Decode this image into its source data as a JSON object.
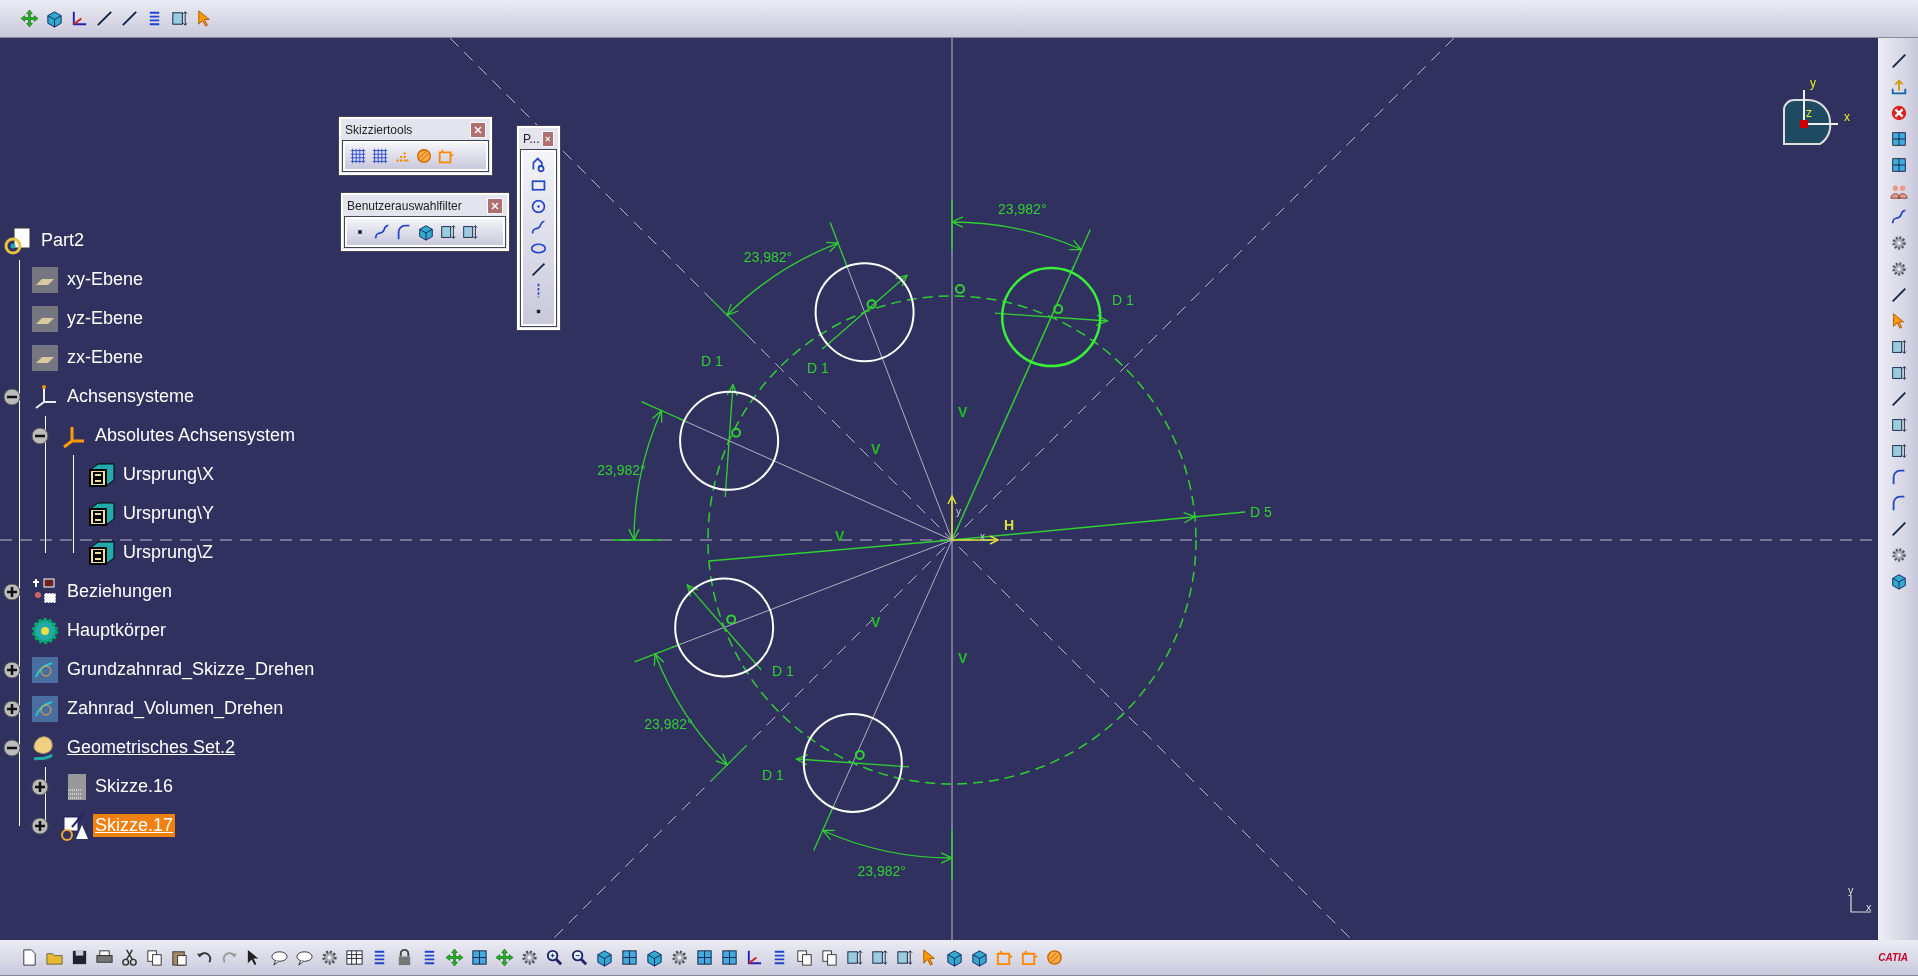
{
  "tree": [
    {
      "label": "Part2",
      "kind": "part",
      "selected": false,
      "in_work": false,
      "children": [
        {
          "label": "xy-Ebene",
          "kind": "plane",
          "selected": false,
          "in_work": false
        },
        {
          "label": "yz-Ebene",
          "kind": "plane",
          "selected": false,
          "in_work": false
        },
        {
          "label": "zx-Ebene",
          "kind": "plane",
          "selected": false,
          "in_work": false
        },
        {
          "label": "Achsensysteme",
          "kind": "axis-set",
          "selected": false,
          "in_work": false,
          "expanded": true,
          "children": [
            {
              "label": "Absolutes Achsensystem",
              "kind": "axis",
              "selected": false,
              "in_work": false,
              "expanded": true,
              "children": [
                {
                  "label": "Ursprung\\X",
                  "kind": "point",
                  "selected": false,
                  "in_work": false
                },
                {
                  "label": "Ursprung\\Y",
                  "kind": "point",
                  "selected": false,
                  "in_work": false
                },
                {
                  "label": "Ursprung\\Z",
                  "kind": "point",
                  "selected": false,
                  "in_work": false
                }
              ]
            }
          ]
        },
        {
          "label": "Beziehungen",
          "kind": "relations",
          "selected": false,
          "in_work": false,
          "expanded": false
        },
        {
          "label": "Hauptkörper",
          "kind": "body",
          "selected": false,
          "in_work": false
        },
        {
          "label": "Grundzahnrad_Skizze_Drehen",
          "kind": "shape",
          "selected": false,
          "in_work": false,
          "expanded": false
        },
        {
          "label": "Zahnrad_Volumen_Drehen",
          "kind": "shape",
          "selected": false,
          "in_work": false,
          "expanded": false
        },
        {
          "label": "Geometrisches Set.2",
          "kind": "set",
          "selected": false,
          "in_work": true,
          "expanded": true,
          "children": [
            {
              "label": "Skizze.16",
              "kind": "sketch",
              "selected": false,
              "in_work": false,
              "expanded": false
            },
            {
              "label": "Skizze.17",
              "kind": "sketch-edit",
              "selected": true,
              "in_work": true,
              "expanded": false
            }
          ]
        }
      ]
    }
  ],
  "floating_toolbars": [
    {
      "title": "Skizziertools"
    },
    {
      "title": "Benutzerauswahlfilter"
    },
    {
      "title": "P..."
    }
  ],
  "sketch": {
    "holes": [
      {
        "selected": true,
        "diameter_label": "D 1",
        "angle_label": "23,982°"
      },
      {
        "selected": false,
        "diameter_label": "D 1",
        "angle_label": "23,982°"
      },
      {
        "selected": false,
        "diameter_label": "D 1",
        "angle_label": "23,982°"
      },
      {
        "selected": false,
        "diameter_label": "D 1",
        "angle_label": "23,982°"
      },
      {
        "selected": false,
        "diameter_label": "D 1",
        "angle_label": "23,982°"
      }
    ],
    "radius_label": "D 5",
    "constraints": [
      "V",
      "V",
      "V",
      "V",
      "V",
      "H"
    ],
    "origin_axes": {
      "x": "x",
      "y": "y"
    }
  },
  "compass": {
    "x": "x",
    "y": "y",
    "z": "z"
  },
  "corner_axes": {
    "x": "x",
    "y": "y"
  },
  "logo": "CATIA"
}
